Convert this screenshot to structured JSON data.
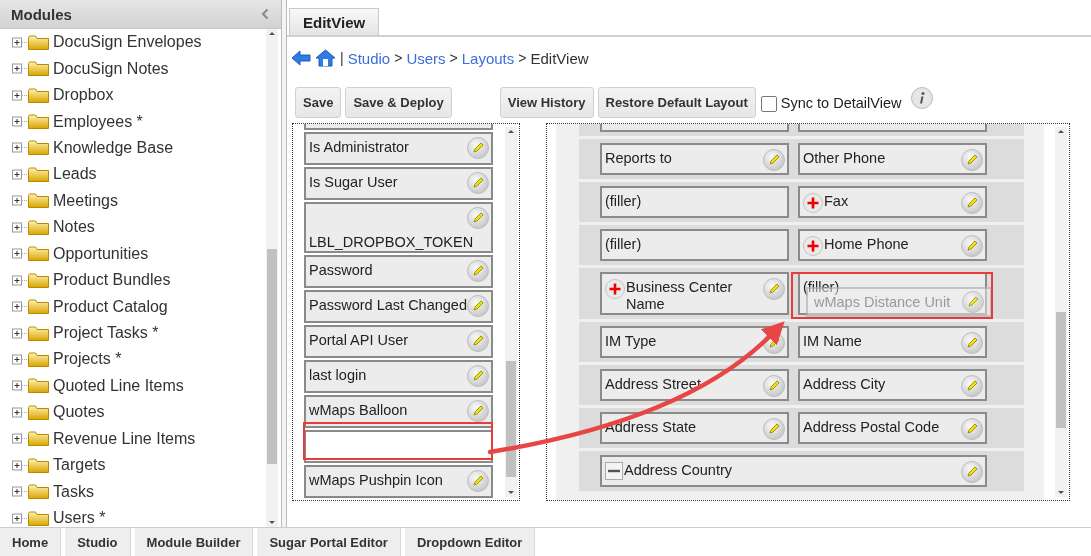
{
  "sidebar": {
    "title": "Modules",
    "items": [
      {
        "label": "DocuSign Envelopes",
        "expanded": false
      },
      {
        "label": "DocuSign Notes",
        "expanded": false
      },
      {
        "label": "Dropbox",
        "expanded": false
      },
      {
        "label": "Employees *",
        "expanded": false
      },
      {
        "label": "Knowledge Base",
        "expanded": false
      },
      {
        "label": "Leads",
        "expanded": false
      },
      {
        "label": "Meetings",
        "expanded": false
      },
      {
        "label": "Notes",
        "expanded": false
      },
      {
        "label": "Opportunities",
        "expanded": false
      },
      {
        "label": "Product Bundles",
        "expanded": false
      },
      {
        "label": "Product Catalog",
        "expanded": false
      },
      {
        "label": "Project Tasks *",
        "expanded": false
      },
      {
        "label": "Projects *",
        "expanded": false
      },
      {
        "label": "Quoted Line Items",
        "expanded": false
      },
      {
        "label": "Quotes",
        "expanded": false
      },
      {
        "label": "Revenue Line Items",
        "expanded": false
      },
      {
        "label": "Targets",
        "expanded": false
      },
      {
        "label": "Tasks",
        "expanded": false
      },
      {
        "label": "Users *",
        "expanded": false
      }
    ]
  },
  "tabs": [
    {
      "label": "EditView",
      "selected": true
    }
  ],
  "breadcrumb": {
    "divider": "|",
    "separator": ">",
    "items": [
      {
        "label": "Studio",
        "link": true
      },
      {
        "label": "Users",
        "link": true
      },
      {
        "label": "Layouts",
        "link": true
      },
      {
        "label": "EditView",
        "link": false
      }
    ]
  },
  "toolbar": {
    "groups": [
      [
        "Save",
        "Save & Deploy"
      ],
      [
        "View History",
        "Restore Default Layout"
      ]
    ],
    "sync": {
      "label": "Sync to DetailView",
      "checked": false
    }
  },
  "toolbox": [
    {
      "kind": "field",
      "label": "Is Administrator"
    },
    {
      "kind": "field",
      "label": "Is Sugar User"
    },
    {
      "kind": "field",
      "label": "LBL_DROPBOX_TOKEN"
    },
    {
      "kind": "field",
      "label": "Password"
    },
    {
      "kind": "field",
      "label": "Password Last Changed"
    },
    {
      "kind": "field",
      "label": "Portal API User"
    },
    {
      "kind": "field",
      "label": "last login"
    },
    {
      "kind": "field",
      "label": "wMaps Balloon"
    },
    {
      "kind": "empty"
    },
    {
      "kind": "field",
      "label": "wMaps Pushpin Icon"
    }
  ],
  "layout_rows": [
    {
      "cells": [
        {
          "kind": "field",
          "label": "Reports to",
          "required": false
        },
        {
          "kind": "field",
          "label": "Other Phone",
          "required": false
        }
      ]
    },
    {
      "cells": [
        {
          "kind": "filler",
          "label": "(filler)"
        },
        {
          "kind": "field",
          "label": "Fax",
          "required": true
        }
      ]
    },
    {
      "cells": [
        {
          "kind": "filler",
          "label": "(filler)"
        },
        {
          "kind": "field",
          "label": "Home Phone",
          "required": true
        }
      ]
    },
    {
      "cells": [
        {
          "kind": "field",
          "label": "Business Center Name",
          "required": true
        },
        {
          "kind": "filler",
          "label": "(filler)",
          "ghost": "wMaps Distance Unit"
        }
      ]
    },
    {
      "cells": [
        {
          "kind": "field",
          "label": "IM Type",
          "required": false
        },
        {
          "kind": "field",
          "label": "IM Name",
          "required": false
        }
      ]
    },
    {
      "cells": [
        {
          "kind": "field",
          "label": "Address Street",
          "required": false
        },
        {
          "kind": "field",
          "label": "Address City",
          "required": false
        }
      ]
    },
    {
      "cells": [
        {
          "kind": "field",
          "label": "Address State",
          "required": false
        },
        {
          "kind": "field",
          "label": "Address Postal Code",
          "required": false
        }
      ]
    },
    {
      "cells": [
        {
          "kind": "wide",
          "label": "Address Country",
          "required": false
        }
      ]
    }
  ],
  "footer_tabs": [
    "Home",
    "Studio",
    "Module Builder",
    "Sugar Portal Editor",
    "Dropdown Editor"
  ]
}
